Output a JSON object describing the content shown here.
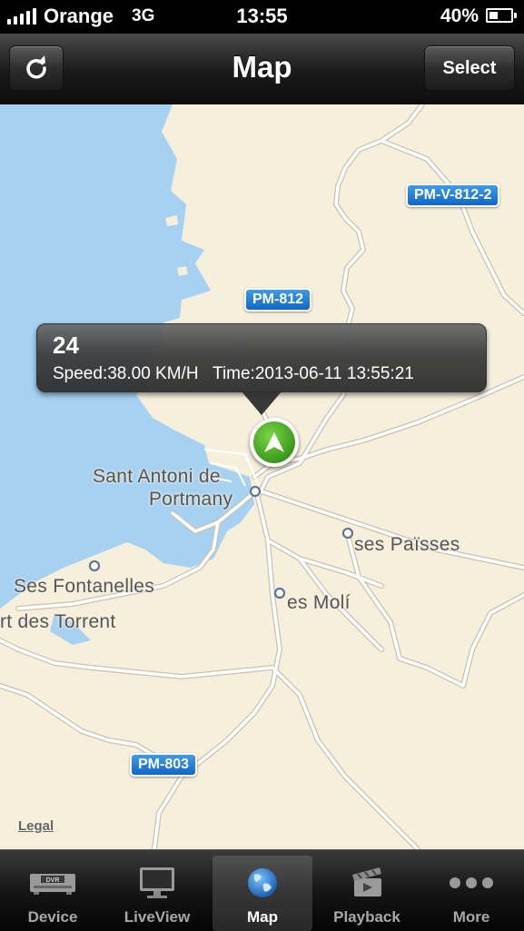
{
  "status_bar": {
    "carrier": "Orange",
    "network": "3G",
    "time": "13:55",
    "battery_percent": "40%",
    "battery_level": 0.4,
    "icons": [
      "signal-icon",
      "battery-icon"
    ]
  },
  "nav_bar": {
    "title": "Map",
    "refresh_icon": "refresh-icon",
    "select_label": "Select"
  },
  "map": {
    "places": [
      "Sant Antoni de",
      "Portmany",
      "ses Païsses",
      "Ses Fontanelles",
      "rt des Torrent",
      "es Molí"
    ],
    "road_shields": [
      "PM-V-812-2",
      "PM-812",
      "PM-803"
    ],
    "legal_link": "Legal",
    "colors": {
      "land": "#f5efdc",
      "water": "#a7d1f1",
      "shield": "#1a75d2",
      "pin": "#4caf2a"
    }
  },
  "callout": {
    "title": "24",
    "subtitle": "Speed:38.00 KM/H   Time:2013-06-11 13:55:21",
    "marker_icon": "navigation-arrow-icon"
  },
  "tab_bar": {
    "items": [
      {
        "label": "Device",
        "icon": "dvr-icon",
        "active": false
      },
      {
        "label": "LiveView",
        "icon": "monitor-icon",
        "active": false
      },
      {
        "label": "Map",
        "icon": "globe-icon",
        "active": true
      },
      {
        "label": "Playback",
        "icon": "clapperboard-icon",
        "active": false
      },
      {
        "label": "More",
        "icon": "more-dots-icon",
        "active": false
      }
    ]
  }
}
